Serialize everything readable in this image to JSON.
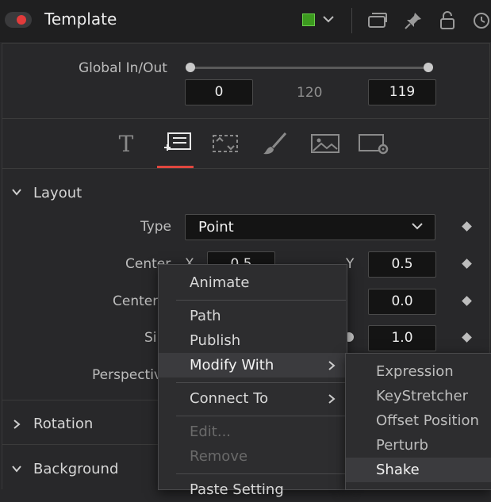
{
  "header": {
    "title": "Template",
    "node_enabled": true,
    "color_swatch": "#3c9a1f",
    "icons": [
      "toggle-icon",
      "color-dropdown-icon",
      "versions-icon",
      "pin-icon",
      "lock-icon",
      "reset-icon"
    ]
  },
  "global_in_out": {
    "label": "Global In/Out",
    "in_value": "0",
    "mid_value": "120",
    "out_value": "119"
  },
  "inspector_tabs": [
    {
      "name": "text-tab",
      "icon": "text-icon"
    },
    {
      "name": "layout-tab",
      "icon": "layout-icon",
      "active": true
    },
    {
      "name": "transform-tab",
      "icon": "transform-icon"
    },
    {
      "name": "shading-tab",
      "icon": "brush-icon"
    },
    {
      "name": "image-tab",
      "icon": "image-icon"
    },
    {
      "name": "settings-tab",
      "icon": "settings-icon"
    }
  ],
  "accent_color": "#e0473f",
  "layout": {
    "title": "Layout",
    "type_label": "Type",
    "type_value": "Point",
    "center_label": "Center",
    "center_x_letter": "X",
    "center_x": "0.5",
    "center_y_letter": "Y",
    "center_y": "0.5",
    "center_z_label": "Center",
    "center_z": "0.0",
    "size_label": "Si",
    "size_value": "1.0",
    "perspective_label": "Perspectiv"
  },
  "sections": {
    "rotation": "Rotation",
    "background": "Background"
  },
  "context_menu": {
    "items": [
      {
        "label": "Animate",
        "state": "normal"
      },
      {
        "label": "Path",
        "state": "normal"
      },
      {
        "label": "Publish",
        "state": "normal"
      },
      {
        "label": "Modify With",
        "state": "hover",
        "submenu": true
      },
      {
        "label": "Connect To",
        "state": "normal",
        "submenu": true
      },
      {
        "label": "Edit...",
        "state": "disabled"
      },
      {
        "label": "Remove",
        "state": "disabled"
      },
      {
        "label": "Paste Setting",
        "state": "normal"
      }
    ]
  },
  "submenu": {
    "items": [
      "Expression",
      "KeyStretcher",
      "Offset Position",
      "Perturb",
      "Shake"
    ],
    "highlighted": "Shake"
  }
}
